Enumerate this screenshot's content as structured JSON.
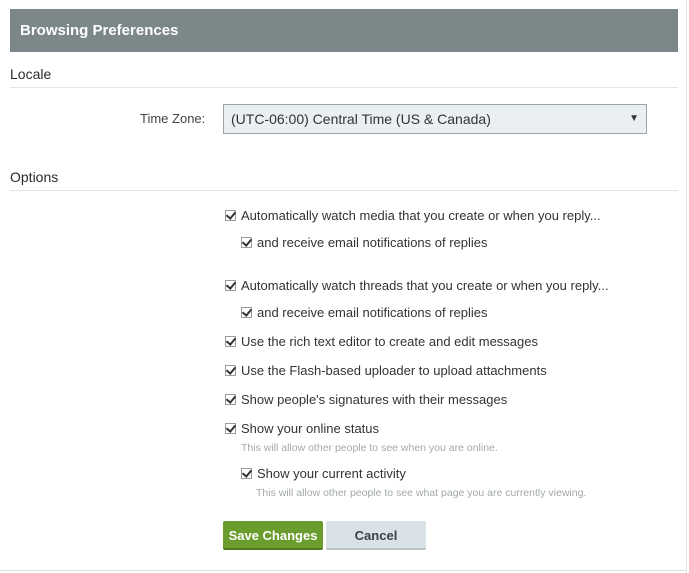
{
  "header": {
    "title": "Browsing Preferences"
  },
  "locale": {
    "section_title": "Locale",
    "timezone_label": "Time Zone:",
    "timezone_value": "(UTC-06:00) Central Time (US & Canada)"
  },
  "options": {
    "section_title": "Options",
    "items": [
      {
        "label": "Automatically watch media that you create or when you reply...",
        "checked": true
      },
      {
        "label": "and receive email notifications of replies",
        "checked": true
      },
      {
        "label": "Automatically watch threads that you create or when you reply...",
        "checked": true
      },
      {
        "label": "and receive email notifications of replies",
        "checked": true
      },
      {
        "label": "Use the rich text editor to create and edit messages",
        "checked": true
      },
      {
        "label": "Use the Flash-based uploader to upload attachments",
        "checked": true
      },
      {
        "label": "Show people's signatures with their messages",
        "checked": true
      },
      {
        "label": "Show your online status",
        "checked": true,
        "hint": "This will allow other people to see when you are online."
      },
      {
        "label": "Show your current activity",
        "checked": true,
        "hint": "This will allow other people to see what page you are currently viewing."
      }
    ]
  },
  "buttons": {
    "save": "Save Changes",
    "cancel": "Cancel"
  },
  "colors": {
    "header_bg": "#7b8789",
    "save_bg": "#6a9c2e",
    "cancel_bg": "#d9e2e6",
    "select_bg": "#e9eff3"
  }
}
